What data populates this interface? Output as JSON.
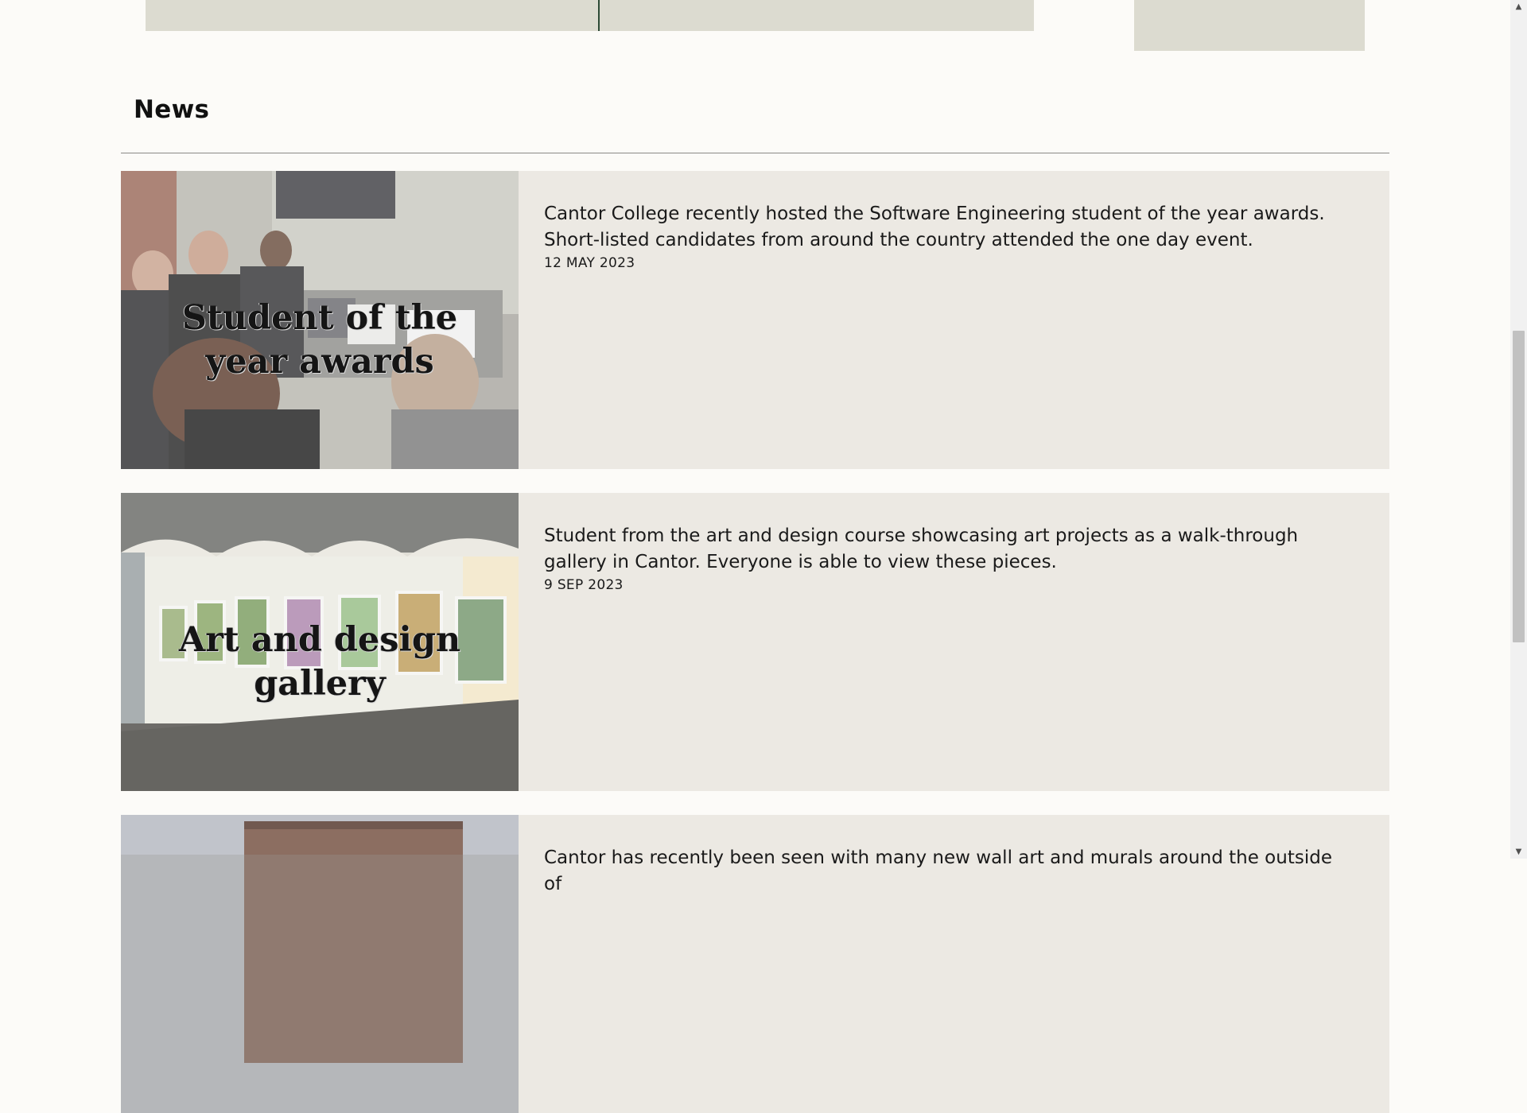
{
  "section": {
    "heading": "News"
  },
  "news": [
    {
      "image_title_line1": "Student of the",
      "image_title_line2": "year awards",
      "summary": "Cantor College recently hosted the Software Engineering student of the year awards. Short-listed candidates from around the country attended the one day event.",
      "date": "12 MAY 2023"
    },
    {
      "image_title_line1": "Art and design",
      "image_title_line2": "gallery",
      "summary": "Student from the art and design course showcasing art projects as a walk-through gallery in Cantor. Everyone is able to view these pieces.",
      "date": "9 SEP 2023"
    },
    {
      "summary": "Cantor has recently been seen with many new wall art and murals around the outside of"
    }
  ],
  "scrollbar": {
    "up_icon": "scroll-up-arrow-icon",
    "down_icon": "scroll-down-arrow-icon",
    "up_glyph": "▲",
    "down_glyph": "▼"
  },
  "colors": {
    "page_background": "#fcfbf8",
    "card_background": "#ece9e3",
    "top_panel": "#dcdbd0",
    "accent_divider": "#2d4a36"
  }
}
